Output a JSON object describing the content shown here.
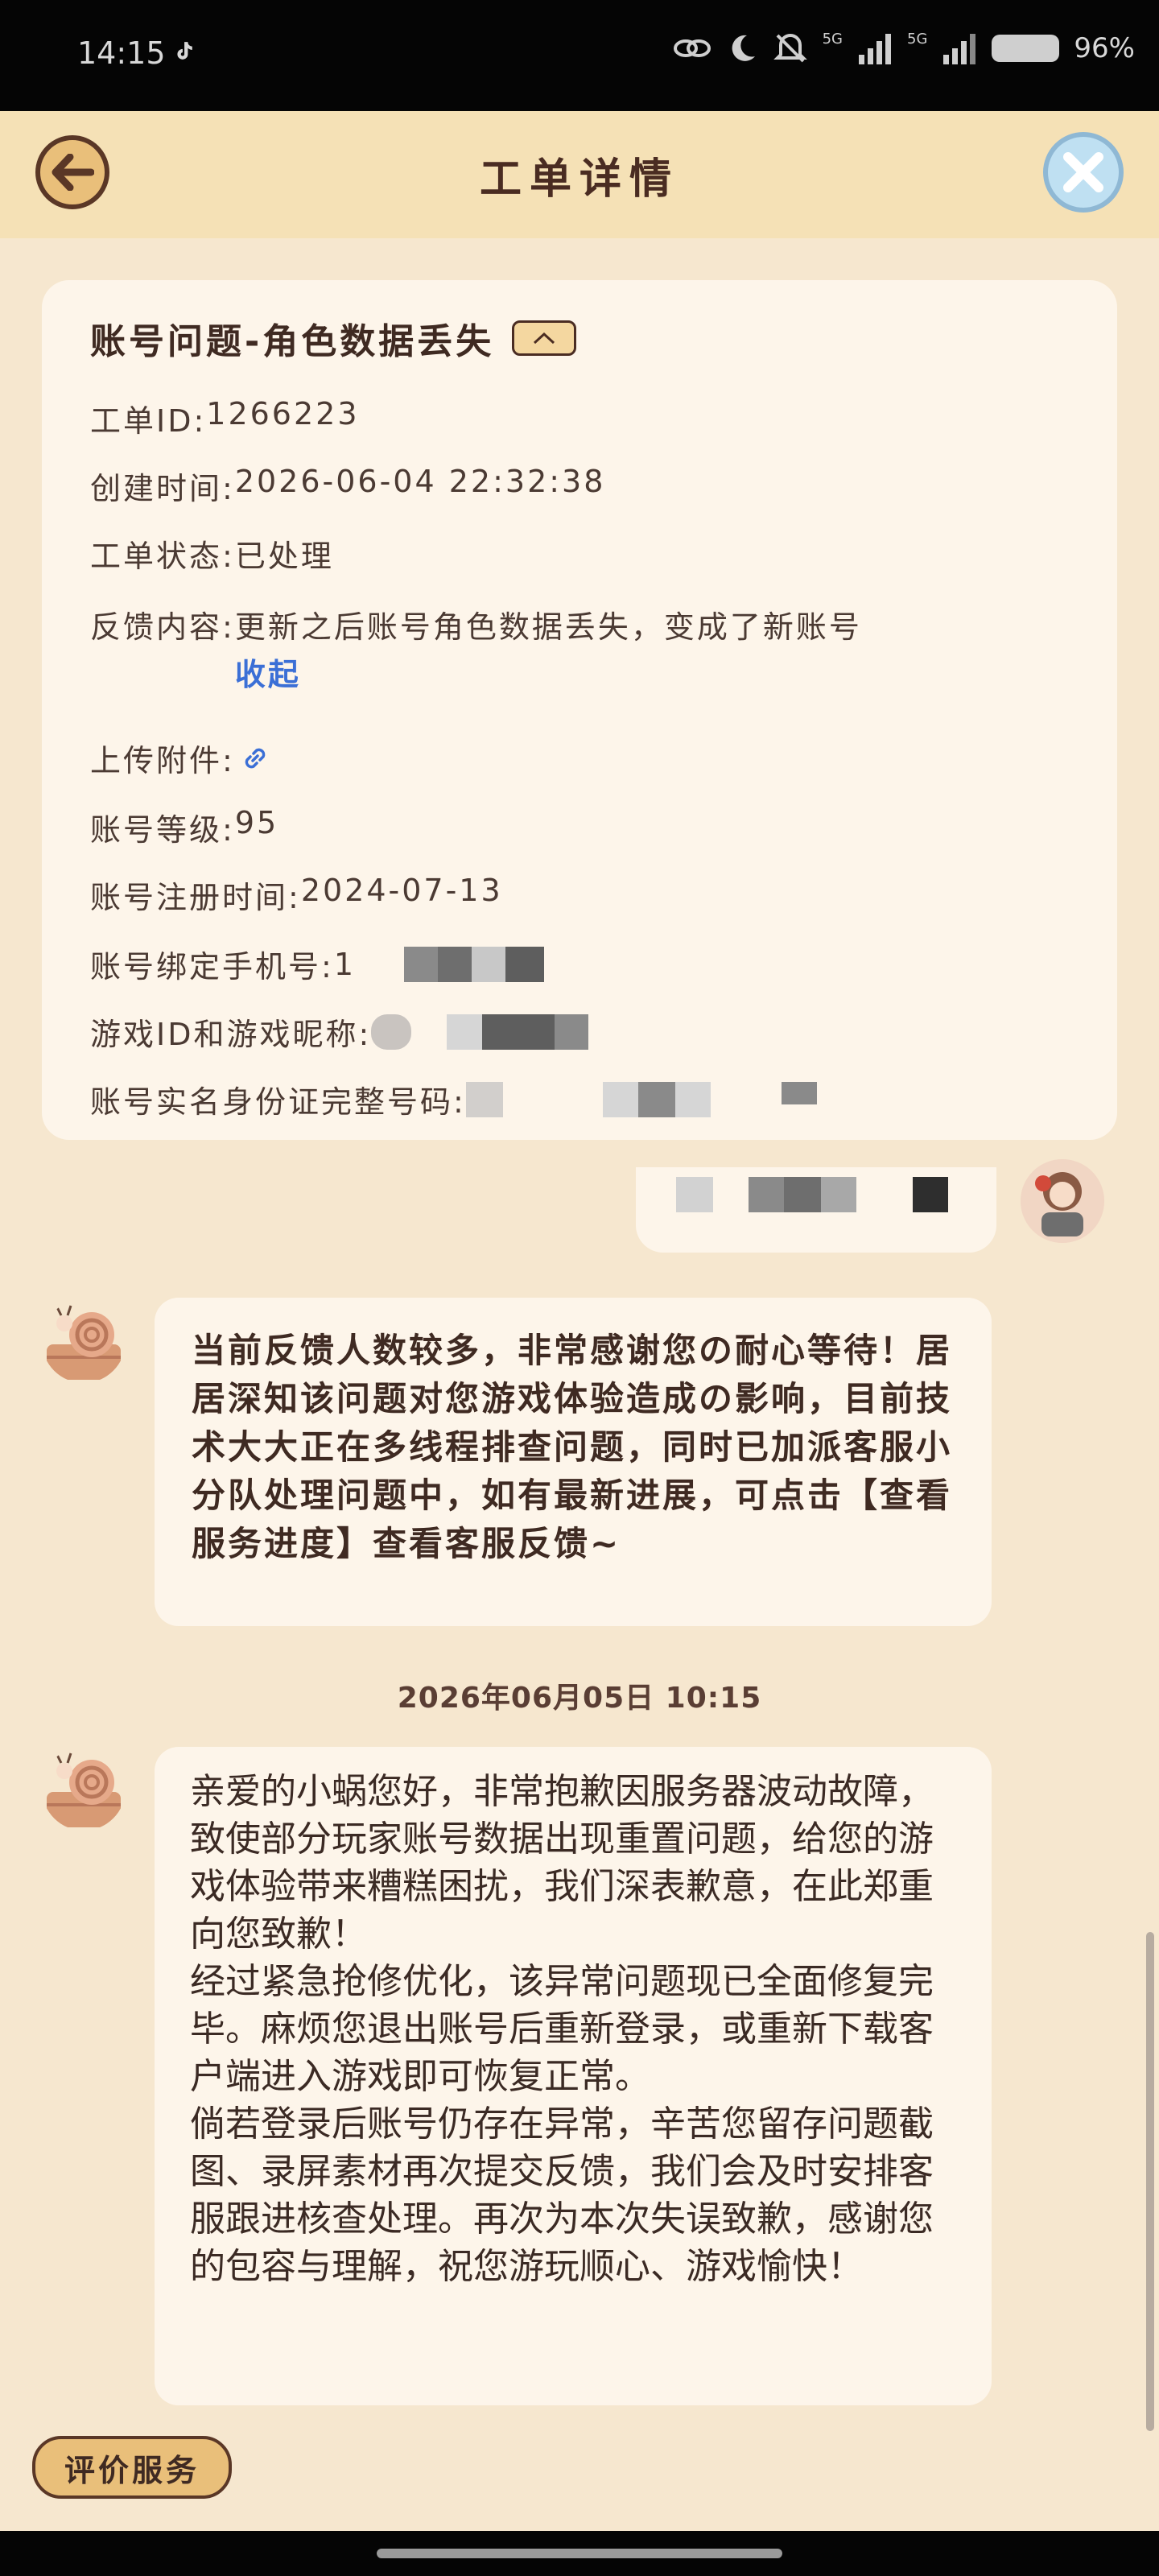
{
  "status_bar": {
    "time": "14:15",
    "network": "5G",
    "battery": "96%"
  },
  "header": {
    "title": "工单详情"
  },
  "ticket": {
    "title": "账号问题-角色数据丢失",
    "id_label": "工单ID:",
    "id_value": "1266223",
    "created_label": "创建时间:",
    "created_value": "2026-06-04 22:32:38",
    "status_label": "工单状态:",
    "status_value": "已处理",
    "feedback_label": "反馈内容:",
    "feedback_value": "更新之后账号角色数据丢失，变成了新账号",
    "collapse_link": "收起",
    "attachment_label": "上传附件:",
    "level_label": "账号等级:",
    "level_value": "95",
    "register_label": "账号注册时间:",
    "register_value": "2024-07-13",
    "phone_label": "账号绑定手机号:",
    "phone_prefix": "1",
    "gameid_label": "游戏ID和游戏昵称:",
    "idcard_label": "账号实名身份证完整号码:"
  },
  "chat": {
    "auto_reply": "当前反馈人数较多，非常感谢您の耐心等待！居居深知该问题对您游戏体验造成の影响，目前技术大大正在多线程排查问题，同时已加派客服小分队处理问题中，如有最新进展，可点击【查看服务进度】查看客服反馈~",
    "timestamp": "2026年06月05日 10:15",
    "reply_p1": "亲爱的小蜗您好，非常抱歉因服务器波动故障，致使部分玩家账号数据出现重置问题，给您的游戏体验带来糟糕困扰，我们深表歉意，在此郑重向您致歉！",
    "reply_p2": "经过紧急抢修优化，该异常问题现已全面修复完毕。麻烦您退出账号后重新登录，或重新下载客户端进入游戏即可恢复正常。",
    "reply_p3": "倘若登录后账号仍存在异常，辛苦您留存问题截图、录屏素材再次提交反馈，我们会及时安排客服跟进核查处理。再次为本次失误致歉，感谢您的包容与理解，祝您游玩顺心、游戏愉快！"
  },
  "footer": {
    "rate_button": "评价服务"
  },
  "colors": {
    "background": "#f6e7cf",
    "header": "#f5e1b6",
    "card": "#fdf5ea",
    "link": "#3b6fd6",
    "button": "#e9bf7a"
  }
}
